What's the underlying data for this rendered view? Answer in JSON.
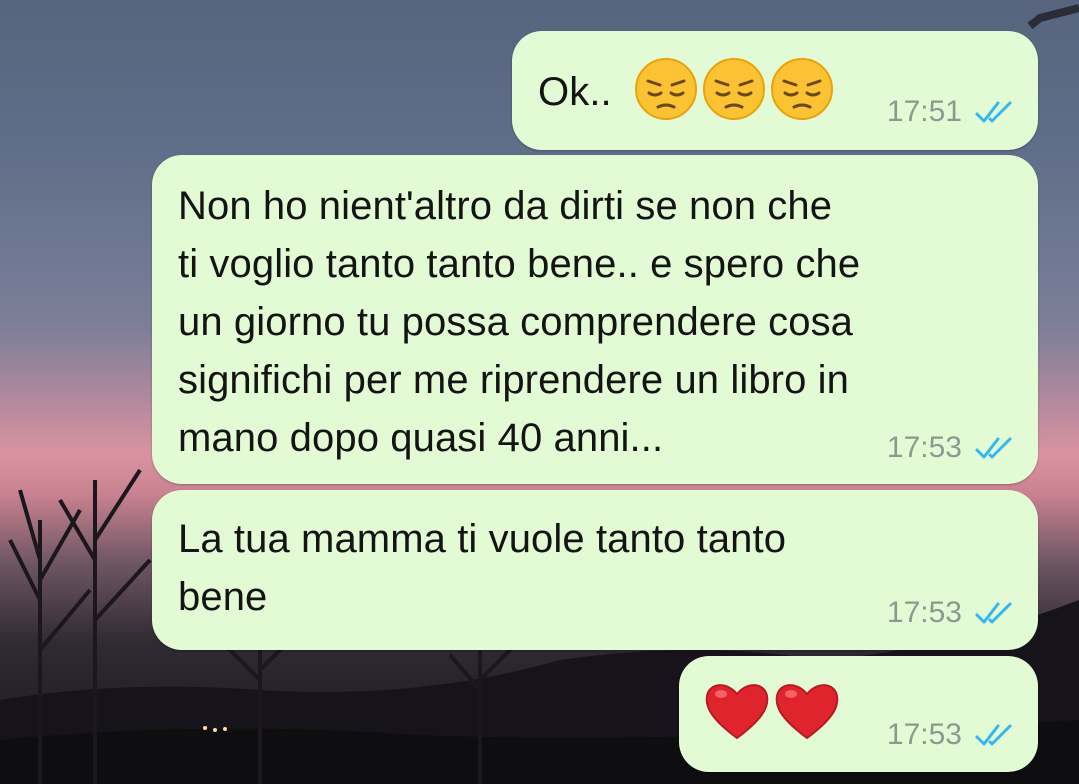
{
  "chat": {
    "messages": [
      {
        "text": "Ok..",
        "emojis": [
          "pensive-face",
          "pensive-face",
          "pensive-face"
        ],
        "time": "17:51",
        "status": "read"
      },
      {
        "text": "Non ho nient'altro da dirti se non che\nti voglio tanto tanto bene.. e spero che\nun giorno tu possa comprendere cosa\nsignifichi per me riprendere un libro in\nmano dopo quasi 40 anni...",
        "time": "17:53",
        "status": "read"
      },
      {
        "text": "La tua mamma ti vuole tanto tanto\nbene",
        "time": "17:53",
        "status": "read"
      },
      {
        "text": "",
        "emojis": [
          "red-heart",
          "red-heart"
        ],
        "time": "17:53",
        "status": "read"
      }
    ]
  },
  "colors": {
    "bubble": "#e2fbd4",
    "tick": "#34b7f1",
    "time": "#8b9a8f"
  }
}
